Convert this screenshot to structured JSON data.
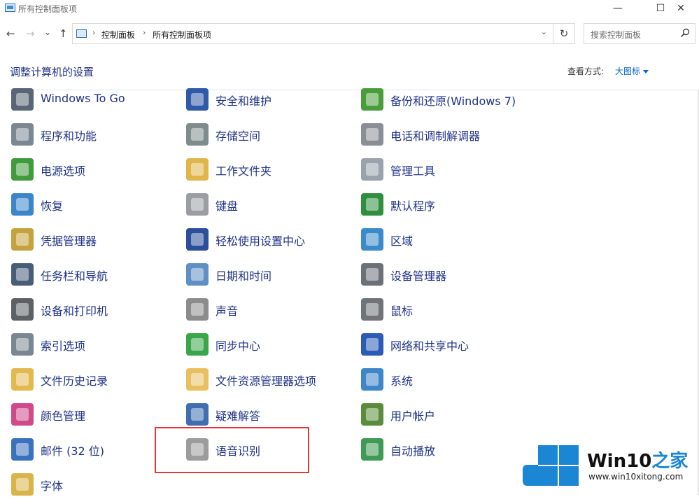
{
  "window": {
    "title": "所有控制面板项",
    "minimize": "—",
    "maximize": "☐",
    "close": "✕"
  },
  "nav": {
    "back": "←",
    "forward": "→",
    "recent": "⌄",
    "up": "↑",
    "refresh": "↻"
  },
  "breadcrumb": [
    "控制面板",
    "所有控制面板项"
  ],
  "search": {
    "placeholder": "搜索控制面板"
  },
  "header": {
    "title": "调整计算机的设置",
    "view_by_label": "查看方式:",
    "view_by_value": "大图标"
  },
  "items": [
    {
      "label": "Windows To Go",
      "icon": "windows-to-go-icon",
      "color": "#5a6675"
    },
    {
      "label": "安全和维护",
      "icon": "flag-icon",
      "color": "#2e5aa8"
    },
    {
      "label": "备份和还原(Windows 7)",
      "icon": "backup-icon",
      "color": "#4a9e3a"
    },
    {
      "label": "程序和功能",
      "icon": "programs-icon",
      "color": "#7c8794"
    },
    {
      "label": "存储空间",
      "icon": "storage-icon",
      "color": "#7f8c8d"
    },
    {
      "label": "电话和调制解调器",
      "icon": "phone-icon",
      "color": "#8a8f96"
    },
    {
      "label": "电源选项",
      "icon": "battery-icon",
      "color": "#3f9b3b"
    },
    {
      "label": "工作文件夹",
      "icon": "work-folder-icon",
      "color": "#e0b54a"
    },
    {
      "label": "管理工具",
      "icon": "admin-tools-icon",
      "color": "#9aa3ad"
    },
    {
      "label": "恢复",
      "icon": "recovery-icon",
      "color": "#3a86c8"
    },
    {
      "label": "键盘",
      "icon": "keyboard-icon",
      "color": "#9a9ea3"
    },
    {
      "label": "默认程序",
      "icon": "default-programs-icon",
      "color": "#2f8f3f"
    },
    {
      "label": "凭据管理器",
      "icon": "credential-icon",
      "color": "#c4a23d"
    },
    {
      "label": "轻松使用设置中心",
      "icon": "ease-of-access-icon",
      "color": "#2b4f9a"
    },
    {
      "label": "区域",
      "icon": "globe-clock-icon",
      "color": "#3b8ac9"
    },
    {
      "label": "任务栏和导航",
      "icon": "taskbar-icon",
      "color": "#4a5d78"
    },
    {
      "label": "日期和时间",
      "icon": "calendar-clock-icon",
      "color": "#5f8fc4"
    },
    {
      "label": "设备管理器",
      "icon": "device-manager-icon",
      "color": "#6b7178"
    },
    {
      "label": "设备和打印机",
      "icon": "printer-icon",
      "color": "#5c6166"
    },
    {
      "label": "声音",
      "icon": "speaker-icon",
      "color": "#8c8c8c"
    },
    {
      "label": "鼠标",
      "icon": "mouse-icon",
      "color": "#6e7478"
    },
    {
      "label": "索引选项",
      "icon": "index-icon",
      "color": "#7a8792"
    },
    {
      "label": "同步中心",
      "icon": "sync-icon",
      "color": "#3aa64a"
    },
    {
      "label": "网络和共享中心",
      "icon": "network-icon",
      "color": "#2a5bb5"
    },
    {
      "label": "文件历史记录",
      "icon": "file-history-icon",
      "color": "#e3b94f"
    },
    {
      "label": "文件资源管理器选项",
      "icon": "folder-options-icon",
      "color": "#e8c060"
    },
    {
      "label": "系统",
      "icon": "system-icon",
      "color": "#3e86c6"
    },
    {
      "label": "颜色管理",
      "icon": "color-management-icon",
      "color": "#d04a8a"
    },
    {
      "label": "疑难解答",
      "icon": "troubleshoot-icon",
      "color": "#3f6fb0"
    },
    {
      "label": "用户帐户",
      "icon": "user-accounts-icon",
      "color": "#5b8c3b"
    },
    {
      "label": "邮件 (32 位)",
      "icon": "mail-icon",
      "color": "#3b72c0"
    },
    {
      "label": "语音识别",
      "icon": "microphone-icon",
      "color": "#9c9c9c"
    },
    {
      "label": "自动播放",
      "icon": "autoplay-icon",
      "color": "#3f9a55"
    },
    {
      "label": "字体",
      "icon": "font-icon",
      "color": "#d9b448"
    }
  ],
  "watermark": {
    "brand": "Win10",
    "brand_suffix": "之家",
    "url": "www.win10xitong.com",
    "color": "#1b86d4"
  }
}
